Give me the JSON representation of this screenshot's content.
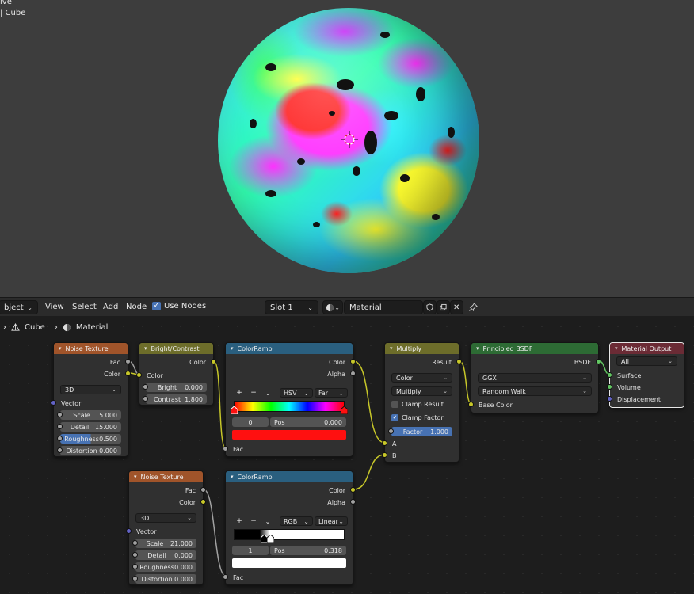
{
  "viewport": {
    "mode_label": "ive",
    "object_label": "| Cube"
  },
  "header": {
    "mode_dropdown": "bject",
    "menu": [
      "View",
      "Select",
      "Add",
      "Node"
    ],
    "use_nodes_label": "Use Nodes",
    "slot_label": "Slot 1",
    "material_name": "Material"
  },
  "breadcrumb": {
    "object": "Cube",
    "material": "Material"
  },
  "nodes": {
    "noise1": {
      "title": "Noise Texture",
      "out_fac": "Fac",
      "out_color": "Color",
      "dimensions": "3D",
      "in_vector": "Vector",
      "scale_label": "Scale",
      "scale_value": "5.000",
      "detail_label": "Detail",
      "detail_value": "15.000",
      "roughness_label": "Roughness",
      "roughness_value": "0.500",
      "distortion_label": "Distortion",
      "distortion_value": "0.000"
    },
    "bright": {
      "title": "Bright/Contrast",
      "out_color": "Color",
      "in_color": "Color",
      "bright_label": "Bright",
      "bright_value": "0.000",
      "contrast_label": "Contrast",
      "contrast_value": "1.800"
    },
    "ramp1": {
      "title": "ColorRamp",
      "out_color": "Color",
      "out_alpha": "Alpha",
      "mode": "HSV",
      "interp": "Far",
      "stop_index": "0",
      "pos_label": "Pos",
      "pos_value": "0.000",
      "in_fac": "Fac",
      "stop_color": "#ff1010"
    },
    "multiply": {
      "title": "Multiply",
      "out_result": "Result",
      "type": "Color",
      "blend": "Multiply",
      "clamp_result": "Clamp Result",
      "clamp_factor": "Clamp Factor",
      "factor_label": "Factor",
      "factor_value": "1.000",
      "in_a": "A",
      "in_b": "B"
    },
    "bsdf": {
      "title": "Principled BSDF",
      "out_bsdf": "BSDF",
      "distribution": "GGX",
      "subsurface": "Random Walk",
      "in_base_color": "Base Color"
    },
    "output": {
      "title": "Material Output",
      "target": "All",
      "in_surface": "Surface",
      "in_volume": "Volume",
      "in_displacement": "Displacement"
    },
    "noise2": {
      "title": "Noise Texture",
      "out_fac": "Fac",
      "out_color": "Color",
      "dimensions": "3D",
      "in_vector": "Vector",
      "scale_label": "Scale",
      "scale_value": "21.000",
      "detail_label": "Detail",
      "detail_value": "0.000",
      "roughness_label": "Roughness",
      "roughness_value": "0.000",
      "distortion_label": "Distortion",
      "distortion_value": "0.000"
    },
    "ramp2": {
      "title": "ColorRamp",
      "out_color": "Color",
      "out_alpha": "Alpha",
      "mode": "RGB",
      "interp": "Linear",
      "stop_index": "1",
      "pos_label": "Pos",
      "pos_value": "0.318",
      "in_fac": "Fac",
      "stop_color": "#ffffff"
    }
  },
  "colors": {
    "accent": "#4772b3",
    "socket_color": "#c7c729",
    "socket_float": "#a1a1a1",
    "socket_vector": "#6363c7",
    "socket_shader": "#63c763"
  }
}
